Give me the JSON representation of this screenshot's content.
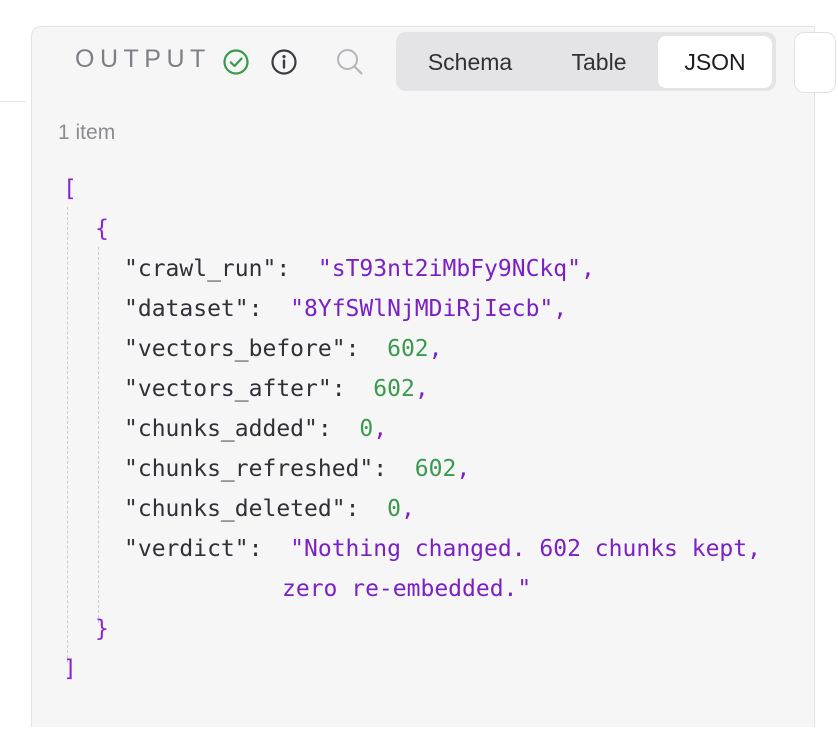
{
  "output_panel": {
    "title": "OUTPUT",
    "icons": {
      "status": "check-circle-icon",
      "info": "info-circle-icon",
      "search": "search-icon"
    },
    "view_tabs": [
      {
        "label": "Schema",
        "active": false
      },
      {
        "label": "Table",
        "active": false
      },
      {
        "label": "JSON",
        "active": true
      }
    ],
    "item_count": "1 item"
  },
  "json_view": {
    "open_array": "[",
    "open_object": "{",
    "fields": [
      {
        "key": "\"crawl_run\"",
        "value": "\"sT93nt2iMbFy9NCkq\"",
        "type": "string"
      },
      {
        "key": "\"dataset\"",
        "value": "\"8YfSWlNjMDiRjIecb\"",
        "type": "string"
      },
      {
        "key": "\"vectors_before\"",
        "value": "602",
        "type": "number"
      },
      {
        "key": "\"vectors_after\"",
        "value": "602",
        "type": "number"
      },
      {
        "key": "\"chunks_added\"",
        "value": "0",
        "type": "number"
      },
      {
        "key": "\"chunks_refreshed\"",
        "value": "602",
        "type": "number"
      },
      {
        "key": "\"chunks_deleted\"",
        "value": "0",
        "type": "number"
      },
      {
        "key": "\"verdict\"",
        "value": "\"Nothing changed. 602 chunks kept,",
        "type": "string"
      }
    ],
    "verdict_continuation": "zero re-embedded.\"",
    "close_object": "}",
    "close_array": "]"
  },
  "colors": {
    "string": "#7b20c4",
    "number": "#3a9a4c",
    "bracket": "#8c24d6",
    "status_ok": "#3a9a4c"
  }
}
